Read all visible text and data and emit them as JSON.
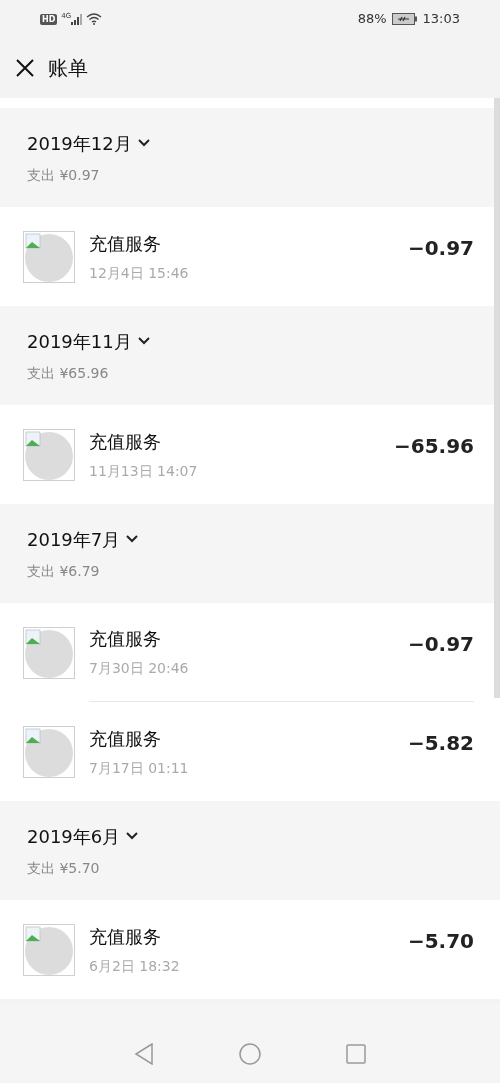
{
  "status_bar": {
    "battery": "88%",
    "time": "13:03",
    "network": "4G",
    "hd": "HD"
  },
  "header": {
    "title": "账单"
  },
  "months": [
    {
      "title": "2019年12月",
      "total": "支出 ¥0.97",
      "items": [
        {
          "name": "充值服务",
          "time": "12月4日 15:46",
          "amount": "−0.97"
        }
      ]
    },
    {
      "title": "2019年11月",
      "total": "支出 ¥65.96",
      "items": [
        {
          "name": "充值服务",
          "time": "11月13日 14:07",
          "amount": "−65.96"
        }
      ]
    },
    {
      "title": "2019年7月",
      "total": "支出 ¥6.79",
      "items": [
        {
          "name": "充值服务",
          "time": "7月30日 20:46",
          "amount": "−0.97"
        },
        {
          "name": "充值服务",
          "time": "7月17日 01:11",
          "amount": "−5.82"
        }
      ]
    },
    {
      "title": "2019年6月",
      "total": "支出 ¥5.70",
      "items": [
        {
          "name": "充值服务",
          "time": "6月2日 18:32",
          "amount": "−5.70"
        }
      ]
    }
  ]
}
